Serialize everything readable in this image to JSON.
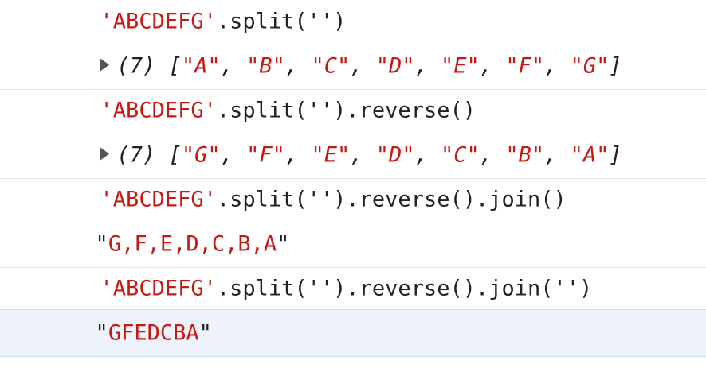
{
  "entries": [
    {
      "kind": "input",
      "string_literal": "'ABCDEFG'",
      "code": ".split('')"
    },
    {
      "kind": "array",
      "length": "(7)",
      "items": [
        "\"A\"",
        "\"B\"",
        "\"C\"",
        "\"D\"",
        "\"E\"",
        "\"F\"",
        "\"G\""
      ]
    },
    {
      "kind": "input",
      "string_literal": "'ABCDEFG'",
      "code": ".split('').reverse()"
    },
    {
      "kind": "array",
      "length": "(7)",
      "items": [
        "\"G\"",
        "\"F\"",
        "\"E\"",
        "\"D\"",
        "\"C\"",
        "\"B\"",
        "\"A\""
      ]
    },
    {
      "kind": "input",
      "string_literal": "'ABCDEFG'",
      "code": ".split('').reverse().join()"
    },
    {
      "kind": "string",
      "value": "\"G,F,E,D,C,B,A\""
    },
    {
      "kind": "input",
      "string_literal": "'ABCDEFG'",
      "code": ".split('').reverse().join('')"
    },
    {
      "kind": "string",
      "value": "\"GFEDCBA\""
    }
  ],
  "colors": {
    "string": "#c41a16",
    "text": "#222222",
    "selected_row": "#eef3fb"
  },
  "icons": {
    "expand": "triangle-right-icon"
  }
}
